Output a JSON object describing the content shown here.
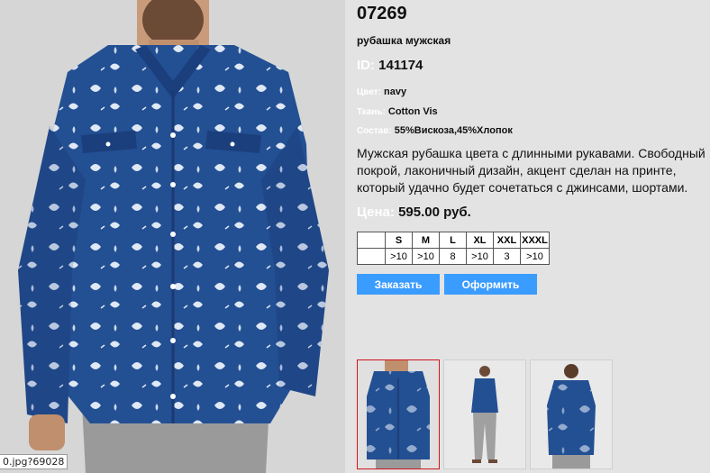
{
  "product": {
    "code": "07269",
    "name": "рубашка мужская",
    "id_label": "ID:",
    "id_value": "141174",
    "color_label": "Цвет:",
    "color_value": "navy",
    "fabric_label": "Ткань:",
    "fabric_value": "Cotton Vis",
    "composition_label": "Состав:",
    "composition_value": "55%Вискоза,45%Хлопок",
    "description": "Мужская рубашка цвета с длинными рукавами. Свободный покрой, лаконичный дизайн, акцент сделан на принте, который удачно будет сочетаться с джинсами, шортами.",
    "price_label": "Цена:",
    "price_value": "595.00 руб."
  },
  "sizes": {
    "headers": [
      "",
      "S",
      "M",
      "L",
      "XL",
      "XXL",
      "XXXL"
    ],
    "stock": [
      "",
      ">10",
      ">10",
      "8",
      ">10",
      "3",
      ">10"
    ]
  },
  "buttons": {
    "order": "Заказать",
    "checkout": "Оформить"
  },
  "image_url_fragment": "0.jpg?69028",
  "colors": {
    "shirt": "#234f93",
    "button": "#3b9cff",
    "selected_thumb_border": "#d0141b"
  }
}
